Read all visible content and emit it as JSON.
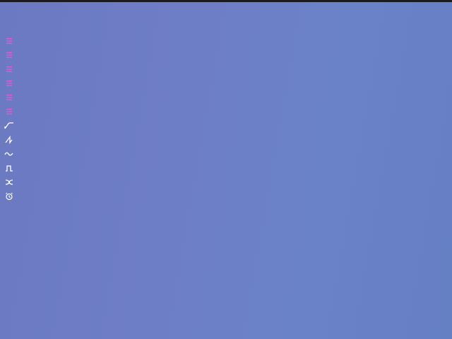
{
  "canvas": {
    "background_color": "#6c7dc4"
  },
  "toolbar": {
    "items": [
      {
        "icon": "menu-icon",
        "color": "#e05ad8"
      },
      {
        "icon": "menu-icon",
        "color": "#e05ad8"
      },
      {
        "icon": "menu-icon",
        "color": "#e05ad8"
      },
      {
        "icon": "menu-icon",
        "color": "#e05ad8"
      },
      {
        "icon": "menu-icon",
        "color": "#e05ad8"
      },
      {
        "icon": "menu-icon",
        "color": "#e05ad8"
      },
      {
        "icon": "ramp-up-icon",
        "color": "#ffffff"
      },
      {
        "icon": "sawtooth-icon",
        "color": "#ffffff"
      },
      {
        "icon": "sine-wave-icon",
        "color": "#ffffff"
      },
      {
        "icon": "square-pulse-icon",
        "color": "#ffffff"
      },
      {
        "icon": "shuffle-icon",
        "color": "#ffffff"
      },
      {
        "icon": "alarm-clock-icon",
        "color": "#ffffff"
      }
    ]
  }
}
